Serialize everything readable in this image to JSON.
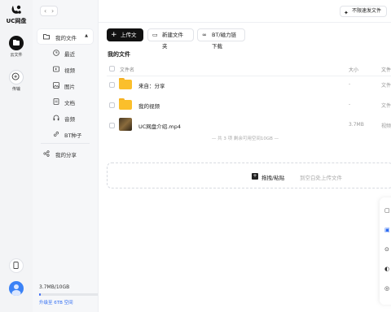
{
  "app": {
    "name": "UC网盘"
  },
  "rail": {
    "items": [
      {
        "label": "云文件",
        "icon": "folder-icon"
      },
      {
        "label": "传输",
        "icon": "transfer-icon"
      }
    ]
  },
  "sidebar": {
    "my_files": "我的文件",
    "categories": [
      {
        "label": "最近",
        "icon": "clock-icon"
      },
      {
        "label": "视频",
        "icon": "video-icon"
      },
      {
        "label": "图片",
        "icon": "image-icon"
      },
      {
        "label": "文档",
        "icon": "document-icon"
      },
      {
        "label": "音频",
        "icon": "headphones-icon"
      },
      {
        "label": "BT种子",
        "icon": "link-icon"
      }
    ],
    "my_share": "我的分享",
    "storage": {
      "text": "3.7MB/10GB",
      "used_fraction": 0.0004
    },
    "upgrade": "升级至 6TB 空间"
  },
  "topbar": {
    "backup_button": "不限速发文件"
  },
  "toolbar": {
    "upload": "上传文件",
    "new_folder": "新建文件夹",
    "bt_download": "BT/磁力链下载"
  },
  "breadcrumb": "我的文件",
  "table": {
    "headers": {
      "name": "文件名",
      "size": "大小",
      "type": "文件"
    },
    "rows": [
      {
        "name": "来自：分享",
        "size": "-",
        "type": "文件",
        "kind": "folder"
      },
      {
        "name": "我的视频",
        "size": "-",
        "type": "文件",
        "kind": "folder"
      },
      {
        "name": "UC网盘介绍.mp4",
        "size": "3.7MB",
        "type": "视频",
        "kind": "video"
      }
    ],
    "summary": "— 共 3 项 剩余可用空间10GB —"
  },
  "dropzone": {
    "main": "拖拽/粘贴",
    "sub": "到空白处上传文件"
  },
  "colors": {
    "accent": "#2d6bf2",
    "folder": "#fbbf2b",
    "primary_button": "#111111"
  }
}
